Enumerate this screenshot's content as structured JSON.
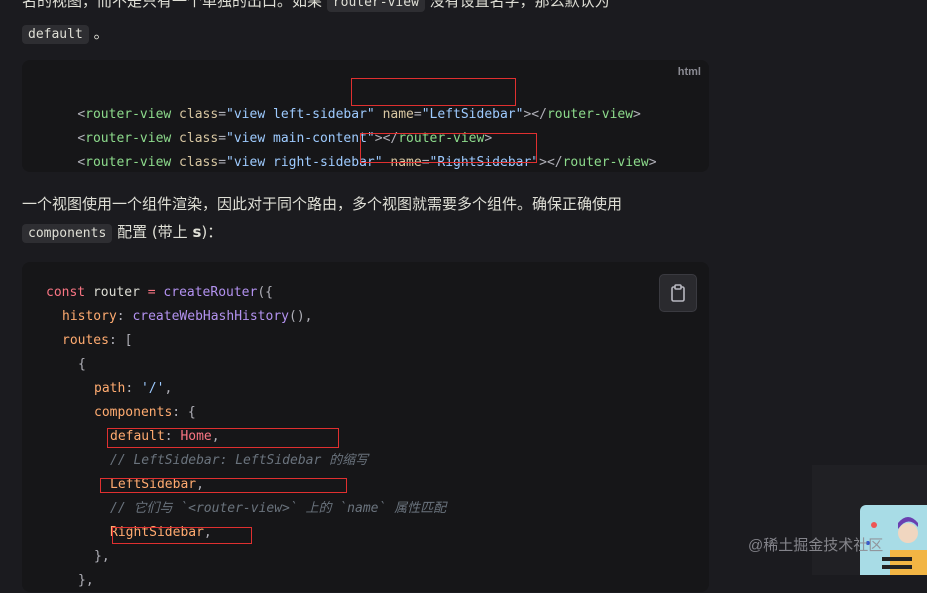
{
  "intro": {
    "line1": "名的视图，而不是只有一个单独的出口。如果",
    "code1": "router-view",
    "line1b": "没有设置名字，那么默认为",
    "code2": "default",
    "end": "。"
  },
  "block1": {
    "lang": "html",
    "lines": [
      [
        "<",
        "router-view",
        " class",
        "=",
        "\"view left-sidebar\"",
        " name",
        "=",
        "\"LeftSidebar\"",
        "></",
        "router-view",
        ">"
      ],
      [
        "<",
        "router-view",
        " class",
        "=",
        "\"view main-content\"",
        "",
        "",
        "",
        "></",
        "router-view",
        ">"
      ],
      [
        "<",
        "router-view",
        " class",
        "=",
        "\"view right-sidebar\"",
        " name",
        "=",
        "\"RightSidebar\"",
        "></",
        "router-view",
        ">"
      ]
    ]
  },
  "mid": {
    "text1": "一个视图使用一个组件渲染，因此对于同个路由，多个视图就需要多个组件。确保正确使用",
    "code": "components",
    "text2": "配置 (带上",
    "bold": "s",
    "text3": ")："
  },
  "block2": {
    "copy_icon": "clipboard-icon",
    "l1_kw": "const",
    "l1_var": " router ",
    "l1_op": "=",
    "l1_fn": " createRouter",
    "l1_p": "({",
    "l2_prop": "history",
    "l2_p": ": ",
    "l2_fn": "createWebHashHistory",
    "l2_e": "(),",
    "l3_prop": "routes",
    "l3_p": ": [",
    "l4": "{",
    "l5_prop": "path",
    "l5_p": ": ",
    "l5_str": "'/'",
    "l5_e": ",",
    "l6_prop": "components",
    "l6_p": ": {",
    "l7_prop": "default",
    "l7_p": ": ",
    "l7_val": "Home",
    "l7_e": ",",
    "l8_comment": "// LeftSidebar: LeftSidebar 的缩写",
    "l9_val": "LeftSidebar",
    "l9_e": ",",
    "l10_comment": "// 它们与 `<router-view>` 上的 `name` 属性匹配",
    "l11_val": "RightSidebar",
    "l11_e": ",",
    "l12": "},",
    "l13": "},"
  },
  "watermark": "@稀土掘金技术社区",
  "colors": {
    "highlight_box": "#e03030",
    "background": "#1b1b1f",
    "code_bg": "#161618"
  }
}
